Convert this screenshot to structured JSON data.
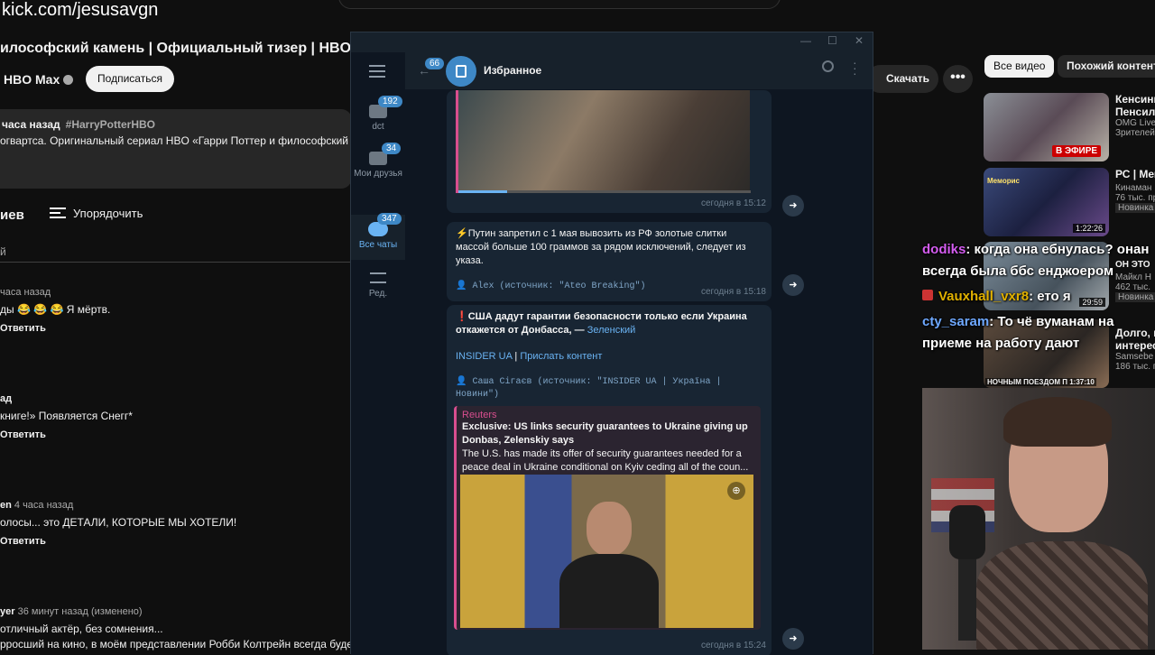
{
  "stream": {
    "url": "kick.com/jesusavgn"
  },
  "youtube": {
    "video_title": "илософский камень | Официальный тизер | HBO Ма",
    "channel_name": "HBO Max",
    "subscribe_label": "Подписаться",
    "desc_meta": "часа назад",
    "desc_tag": "#HarryPotterHBO",
    "desc_text": "огвартса. Оригинальный сериал HBO «Гарри Поттер и философский ка",
    "comments_header": "иев",
    "sort_label": "Упорядочить",
    "add_comment": "й",
    "download_label": "Скачать",
    "more_label": "•••",
    "chips": [
      "Все видео",
      "Похожий контент"
    ],
    "comments": [
      {
        "meta": "часа назад",
        "author": "",
        "text": "ды 😂 😂 😂  Я мёртв.",
        "reply": "Ответить"
      },
      {
        "meta": "",
        "author": "ад",
        "text": "книге!» Появляется Снегг*",
        "reply": "Ответить"
      },
      {
        "meta": "4 часа назад",
        "author": "en",
        "text": "олосы... это ДЕТАЛИ, КОТОРЫЕ МЫ ХОТЕЛИ!",
        "reply": "Ответить"
      },
      {
        "meta": "36 минут назад (изменено)",
        "author": "yer",
        "text": "отличный актёр, без сомнения...",
        "text2": "рросший на кино, в моём представлении Робби Колтрейн всегда будет",
        "reply": ""
      }
    ],
    "recommendations": [
      {
        "title": "Кенсинг",
        "title2": "Пенсилв",
        "channel": "OMG Live",
        "stats": "Зрителей",
        "badge": "В ЭФИРЕ",
        "duration": ""
      },
      {
        "title": "РС | Мем",
        "title2": "",
        "channel": "Кинаман",
        "stats": "76 тыс. пр",
        "badge": "Новинка",
        "duration": "1:22:26",
        "thumb_text": "Меморис"
      },
      {
        "title": "",
        "title2": "",
        "channel": "Майкл Н",
        "stats": "462 тыс.",
        "badge": "Новинка",
        "duration": "29:59",
        "thumb_text": "ОН ЭТО"
      },
      {
        "title": "Долго, н",
        "title2": "интерес",
        "channel": "Samsebe",
        "stats": "186 тыс. п",
        "badge": "",
        "duration": "1:37:10",
        "thumb_text": "НОЧНЫМ ПОЕЗДОМ П"
      }
    ]
  },
  "chat_overlay": [
    {
      "user": "dodiks",
      "user_color": "#d45cf0",
      "text": ": когда она ебнулась? онан"
    },
    {
      "user": "",
      "user_color": "#ffffff",
      "text": "всегда была ббс енджоером"
    },
    {
      "user": "Vauxhall_vxr8",
      "user_color": "#e0b000",
      "text": ": ето я"
    },
    {
      "user": "cty_saram",
      "user_color": "#6ea8ff",
      "text": ": То чё вуманам на"
    },
    {
      "user": "",
      "user_color": "#ffffff",
      "text": "приеме на работу дают"
    }
  ],
  "telegram": {
    "chat_title": "Избранное",
    "back_badge": "66",
    "folders": [
      {
        "label": "dct",
        "badge": "192"
      },
      {
        "label": "Мои друзья",
        "badge": "34"
      },
      {
        "label": "Все чаты",
        "badge": "347"
      },
      {
        "label": "Ред.",
        "badge": ""
      }
    ],
    "messages": [
      {
        "time": "сегодня в 15:12"
      },
      {
        "text": "⚡Путин запретил с 1 мая вывозить из РФ золотые слитки массой больше 100 граммов за рядом исключений, следует из указа.",
        "source": "👤 Alex (источник: \"Ateo Breaking\")",
        "time": "сегодня в 15:18"
      },
      {
        "text": "❗США дадут гарантии безопасности только если Украина откажется от Донбасса, — ",
        "text_link": "Зеленский",
        "insider": "INSIDER UA",
        "separator": " | ",
        "send_content": "Прислать контент",
        "source": "👤 Саша Сігаєв (источник: \"INSIDER UA | Україна | Новини\")",
        "preview_site": "Reuters",
        "preview_title": "Exclusive: US links security guarantees to Ukraine giving up Donbas, Zelenskiy says",
        "preview_desc": "The U.S. has made its offer of security guarantees needed for a peace deal in Ukraine conditional on Kyiv ceding all of the coun...",
        "time": "сегодня в 15:24"
      }
    ]
  },
  "colors": {
    "accent": "#3e88c6",
    "tg_bg": "#0e1621",
    "tg_panel": "#17212b",
    "yt_bg": "#0f0f0f"
  }
}
